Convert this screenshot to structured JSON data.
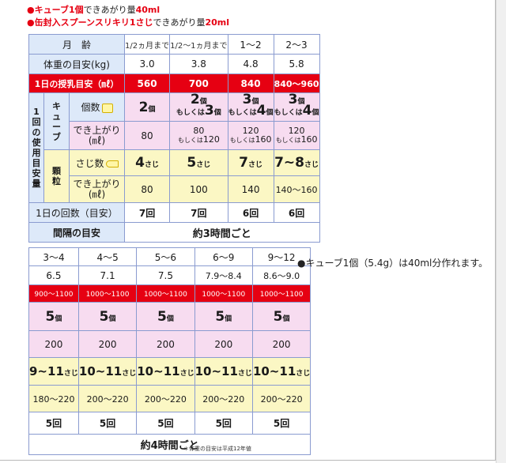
{
  "notes": {
    "cube_prefix": "●キューブ1個",
    "cube_mid": "できあがり量",
    "cube_amount": "40ml",
    "can_prefix": "●缶封入スプーンスリキリ1さじ",
    "can_mid": "できあがり量",
    "can_amount": "20ml"
  },
  "table1": {
    "header_label": "月　齢",
    "months": [
      "1/2ヵ月まで",
      "1/2～1ヵ月まで",
      "1～2",
      "2～3"
    ],
    "weight_label": "体重の目安(kg)",
    "weights": [
      "3.0",
      "3.8",
      "4.8",
      "5.8"
    ],
    "daily_label": "1日の授乳目安（㎖）",
    "daily": [
      "560",
      "700",
      "840",
      "840～960"
    ],
    "side_label": "1回の使用目安量",
    "cube_label": "キューブ",
    "count_label": "個数",
    "cube_counts": [
      {
        "a": "2",
        "a_unit": "個",
        "b": "",
        "b_unit": "",
        "or": ""
      },
      {
        "a": "2",
        "a_unit": "個",
        "b": "3",
        "b_unit": "個",
        "or": "もしくは"
      },
      {
        "a": "3",
        "a_unit": "個",
        "b": "4",
        "b_unit": "個",
        "or": "もしくは"
      },
      {
        "a": "3",
        "a_unit": "個",
        "b": "4",
        "b_unit": "個",
        "or": "もしくは"
      }
    ],
    "finish_label": "でき上がり(㎖)",
    "cube_finish": [
      {
        "a": "80",
        "b": "",
        "or": ""
      },
      {
        "a": "80",
        "b": "120",
        "or": "もしくは"
      },
      {
        "a": "120",
        "b": "160",
        "or": "もしくは"
      },
      {
        "a": "120",
        "b": "160",
        "or": "もしくは"
      }
    ],
    "granule_label": "顆粒",
    "spoon_label": "さじ数",
    "spoons": [
      {
        "v": "4",
        "u": "さじ"
      },
      {
        "v": "5",
        "u": "さじ"
      },
      {
        "v": "7",
        "u": "さじ"
      },
      {
        "v": "7~8",
        "u": "さじ"
      }
    ],
    "finish2_label": "でき上がり(㎖)",
    "granule_finish": [
      "80",
      "100",
      "140",
      "140～160"
    ],
    "times_label": "1日の回数（目安）",
    "times": [
      "7回",
      "7回",
      "6回",
      "6回"
    ],
    "interval_label": "間隔の目安",
    "interval": "約3時間ごと"
  },
  "table2": {
    "months": [
      "3～4",
      "4～5",
      "5～6",
      "6～9",
      "9～12"
    ],
    "weights": [
      "6.5",
      "7.1",
      "7.5",
      "7.9～8.4",
      "8.6～9.0"
    ],
    "daily": [
      "900～1100",
      "1000～1100",
      "1000～1100",
      "1000～1100",
      "1000～1100"
    ],
    "cube_counts": [
      {
        "v": "5",
        "u": "個"
      },
      {
        "v": "5",
        "u": "個"
      },
      {
        "v": "5",
        "u": "個"
      },
      {
        "v": "5",
        "u": "個"
      },
      {
        "v": "5",
        "u": "個"
      }
    ],
    "cube_finish": [
      "200",
      "200",
      "200",
      "200",
      "200"
    ],
    "spoons": [
      {
        "v": "9~11",
        "u": "さじ"
      },
      {
        "v": "10~11",
        "u": "さじ"
      },
      {
        "v": "10~11",
        "u": "さじ"
      },
      {
        "v": "10~11",
        "u": "さじ"
      },
      {
        "v": "10~11",
        "u": "さじ"
      }
    ],
    "granule_finish": [
      "180～220",
      "200～220",
      "200～220",
      "200～220",
      "200～220"
    ],
    "times": [
      "5回",
      "5回",
      "5回",
      "5回",
      "5回"
    ],
    "interval": "約4時間ごと"
  },
  "footnote": "＊体重の目安は平成12年値",
  "side_note": "●キューブ1個（5.4g）は40ml分作れます。"
}
